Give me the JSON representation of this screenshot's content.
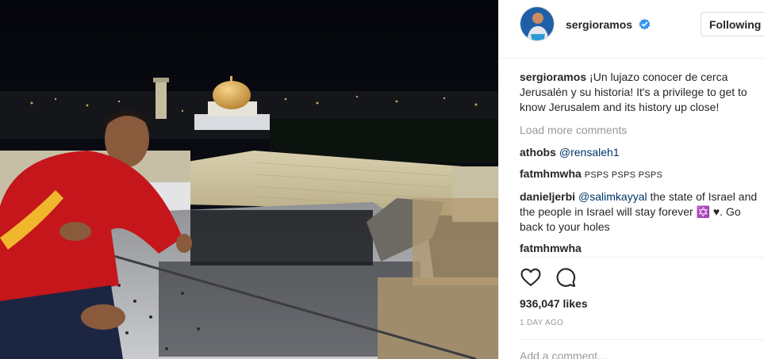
{
  "post": {
    "image_alt": "Sergio Ramos overlooking the Western Wall plaza at night",
    "username": "sergioramos",
    "follow_label": "Following",
    "caption_text": "¡Un lujazo conocer de cerca Jerusalén y su historia! It's a privilege to get to know Jerusalem and its history up close!",
    "load_more_label": "Load more comments",
    "comments": [
      {
        "user": "athobs",
        "mention": "@rensaleh1",
        "text": ""
      },
      {
        "user": "fatmhmwha",
        "mention": "",
        "text": "PSPS PSPS PSPS"
      },
      {
        "user": "danieljerbi",
        "mention": "@salimkayyal",
        "text": " the state of Israel and the people in Israel will stay forever ✡️ ♥. Go back to your holes"
      },
      {
        "user": "fatmhmwha",
        "mention": "",
        "text": ""
      }
    ],
    "likes_label": "936,047 likes",
    "time_label": "1 DAY AGO",
    "add_comment_placeholder": "Add a comment..."
  },
  "icons": {
    "like": "heart-icon",
    "comment": "comment-bubble-icon",
    "verified": "verified-badge-icon"
  },
  "colors": {
    "verified_blue": "#3897f0",
    "mention": "#003569",
    "muted": "#999999",
    "text": "#262626",
    "border": "#dbdbdb"
  }
}
